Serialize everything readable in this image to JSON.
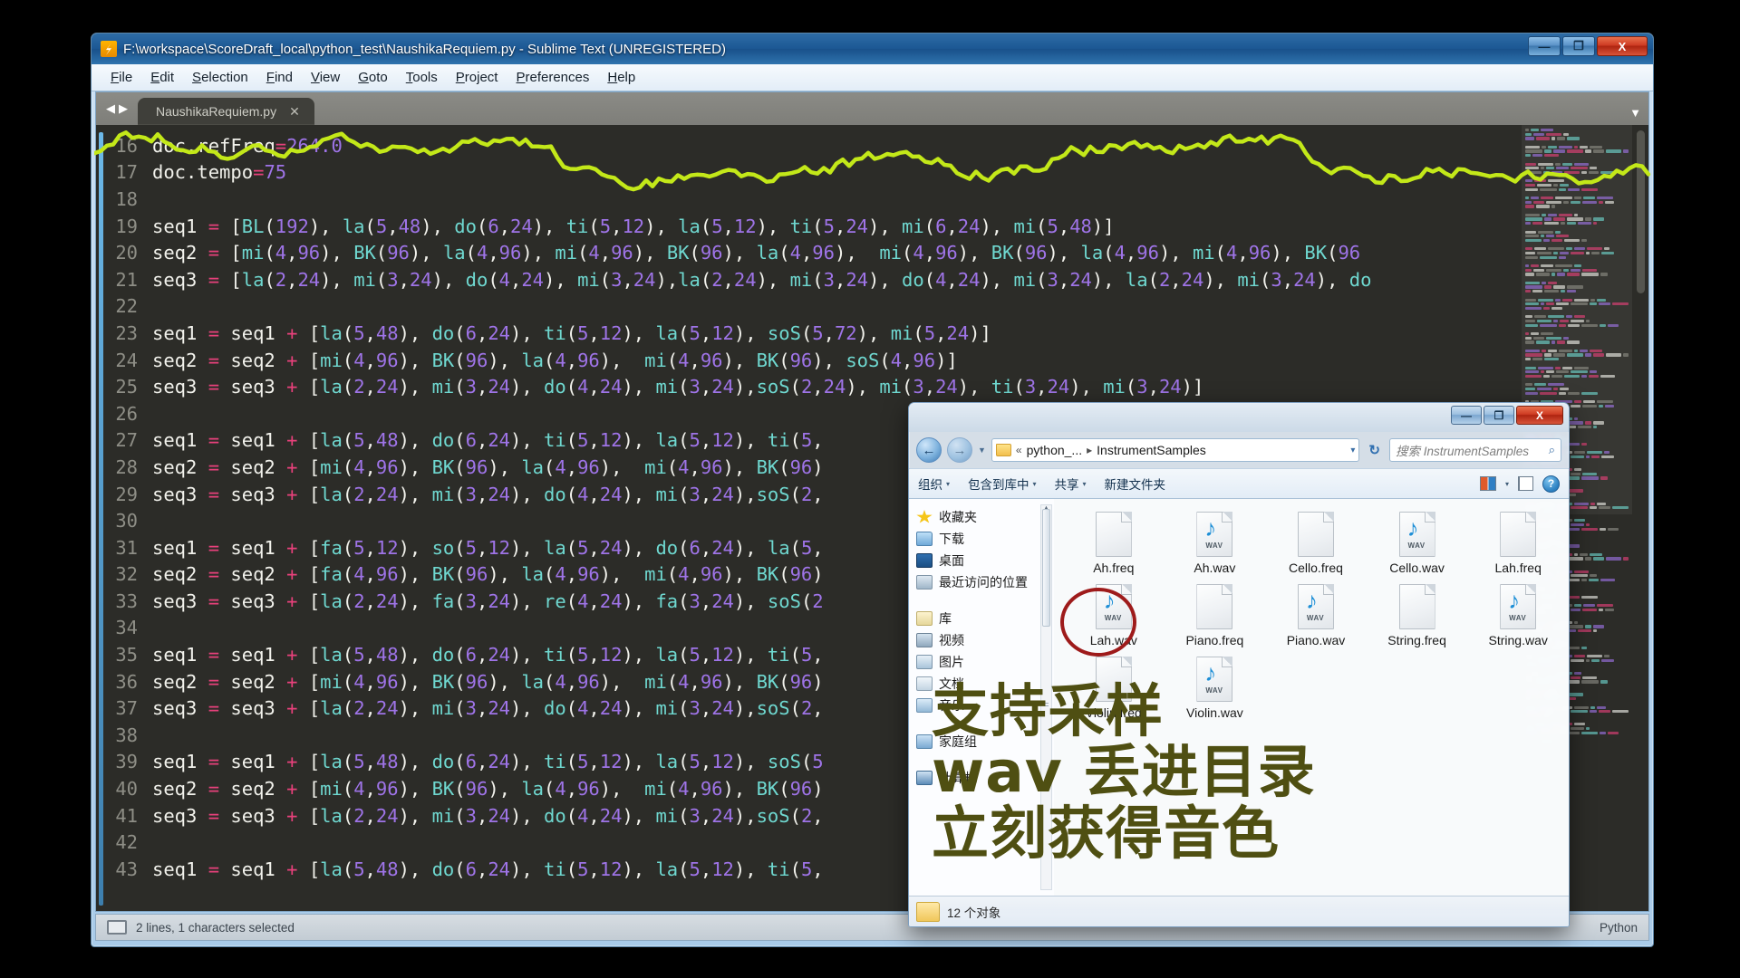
{
  "sublime": {
    "title": "F:\\workspace\\ScoreDraft_local\\python_test\\NaushikaRequiem.py - Sublime Text (UNREGISTERED)",
    "window_buttons": {
      "minimize": "—",
      "maximize": "❐",
      "close": "X"
    },
    "menu": [
      "File",
      "Edit",
      "Selection",
      "Find",
      "View",
      "Goto",
      "Tools",
      "Project",
      "Preferences",
      "Help"
    ],
    "tab": {
      "label": "NaushikaRequiem.py",
      "close": "✕"
    },
    "tab_nav_prev": "◀",
    "tab_nav_next": "▶",
    "tab_overflow": "▼",
    "status_left": "2 lines, 1 characters selected",
    "status_right": "Python",
    "code_lines": [
      {
        "num": "16",
        "text": "doc.refFreq=264.0"
      },
      {
        "num": "17",
        "text": "doc.tempo=75"
      },
      {
        "num": "18",
        "text": ""
      },
      {
        "num": "19",
        "text": "seq1 = [BL(192), la(5,48), do(6,24), ti(5,12), la(5,12), ti(5,24), mi(6,24), mi(5,48)]"
      },
      {
        "num": "20",
        "text": "seq2 = [mi(4,96), BK(96), la(4,96), mi(4,96), BK(96), la(4,96),  mi(4,96), BK(96), la(4,96), mi(4,96), BK(96"
      },
      {
        "num": "21",
        "text": "seq3 = [la(2,24), mi(3,24), do(4,24), mi(3,24),la(2,24), mi(3,24), do(4,24), mi(3,24), la(2,24), mi(3,24), do"
      },
      {
        "num": "22",
        "text": ""
      },
      {
        "num": "23",
        "text": "seq1 = seq1 + [la(5,48), do(6,24), ti(5,12), la(5,12), soS(5,72), mi(5,24)]"
      },
      {
        "num": "24",
        "text": "seq2 = seq2 + [mi(4,96), BK(96), la(4,96),  mi(4,96), BK(96), soS(4,96)]"
      },
      {
        "num": "25",
        "text": "seq3 = seq3 + [la(2,24), mi(3,24), do(4,24), mi(3,24),soS(2,24), mi(3,24), ti(3,24), mi(3,24)]"
      },
      {
        "num": "26",
        "text": ""
      },
      {
        "num": "27",
        "text": "seq1 = seq1 + [la(5,48), do(6,24), ti(5,12), la(5,12), ti(5,"
      },
      {
        "num": "28",
        "text": "seq2 = seq2 + [mi(4,96), BK(96), la(4,96),  mi(4,96), BK(96)"
      },
      {
        "num": "29",
        "text": "seq3 = seq3 + [la(2,24), mi(3,24), do(4,24), mi(3,24),soS(2,"
      },
      {
        "num": "30",
        "text": ""
      },
      {
        "num": "31",
        "text": "seq1 = seq1 + [fa(5,12), so(5,12), la(5,24), do(6,24), la(5,"
      },
      {
        "num": "32",
        "text": "seq2 = seq2 + [fa(4,96), BK(96), la(4,96),  mi(4,96), BK(96)"
      },
      {
        "num": "33",
        "text": "seq3 = seq3 + [la(2,24), fa(3,24), re(4,24), fa(3,24), soS(2"
      },
      {
        "num": "34",
        "text": ""
      },
      {
        "num": "35",
        "text": "seq1 = seq1 + [la(5,48), do(6,24), ti(5,12), la(5,12), ti(5,"
      },
      {
        "num": "36",
        "text": "seq2 = seq2 + [mi(4,96), BK(96), la(4,96),  mi(4,96), BK(96)"
      },
      {
        "num": "37",
        "text": "seq3 = seq3 + [la(2,24), mi(3,24), do(4,24), mi(3,24),soS(2,"
      },
      {
        "num": "38",
        "text": ""
      },
      {
        "num": "39",
        "text": "seq1 = seq1 + [la(5,48), do(6,24), ti(5,12), la(5,12), soS(5"
      },
      {
        "num": "40",
        "text": "seq2 = seq2 + [mi(4,96), BK(96), la(4,96),  mi(4,96), BK(96)"
      },
      {
        "num": "41",
        "text": "seq3 = seq3 + [la(2,24), mi(3,24), do(4,24), mi(3,24),soS(2,"
      },
      {
        "num": "42",
        "text": ""
      },
      {
        "num": "43",
        "text": "seq1 = seq1 + [la(5,48), do(6,24), ti(5,12), la(5,12), ti(5,"
      }
    ]
  },
  "explorer": {
    "window_buttons": {
      "minimize": "—",
      "maximize": "❐",
      "close": "X"
    },
    "back_arrow": "←",
    "forward_arrow": "→",
    "address": {
      "crumb_prefix": "«",
      "crumb1": "python_...",
      "separator": "▸",
      "crumb2": "InstrumentSamples",
      "caret": "▾"
    },
    "refresh": "↻",
    "search_placeholder": "搜索 InstrumentSamples",
    "search_value": "",
    "search_icon": "⌕",
    "toolbar": [
      {
        "label": "组织",
        "caret": "▾"
      },
      {
        "label": "包含到库中",
        "caret": "▾"
      },
      {
        "label": "共享",
        "caret": "▾"
      },
      {
        "label": "新建文件夹",
        "caret": ""
      }
    ],
    "toolbar_view_caret": "▾",
    "help_label": "?",
    "sidebar": [
      {
        "label": "收藏夹",
        "icon": "ico-star"
      },
      {
        "label": "下载",
        "icon": "ico-dl"
      },
      {
        "label": "桌面",
        "icon": "ico-desktop"
      },
      {
        "label": "最近访问的位置",
        "icon": "ico-recent"
      },
      {
        "label": "库",
        "icon": "ico-lib"
      },
      {
        "label": "视频",
        "icon": "ico-video"
      },
      {
        "label": "图片",
        "icon": "ico-pic"
      },
      {
        "label": "文档",
        "icon": "ico-doc"
      },
      {
        "label": "音乐",
        "icon": "ico-music"
      },
      {
        "label": "家庭组",
        "icon": "ico-home"
      },
      {
        "label": "计算机",
        "icon": "ico-pc"
      }
    ],
    "sidebar_scroll_arrow": "▲",
    "files": [
      {
        "name": "Ah.freq",
        "type": "freq",
        "badge": ""
      },
      {
        "name": "Ah.wav",
        "type": "wav",
        "badge": "WAV"
      },
      {
        "name": "Cello.freq",
        "type": "freq",
        "badge": ""
      },
      {
        "name": "Cello.wav",
        "type": "wav",
        "badge": "WAV"
      },
      {
        "name": "Lah.freq",
        "type": "freq",
        "badge": ""
      },
      {
        "name": "Lah.wav",
        "type": "wav",
        "badge": "WAV"
      },
      {
        "name": "Piano.freq",
        "type": "freq",
        "badge": ""
      },
      {
        "name": "Piano.wav",
        "type": "wav",
        "badge": "WAV"
      },
      {
        "name": "String.freq",
        "type": "freq",
        "badge": ""
      },
      {
        "name": "String.wav",
        "type": "wav",
        "badge": "WAV"
      },
      {
        "name": "Violin.freq",
        "type": "freq",
        "badge": ""
      },
      {
        "name": "Violin.wav",
        "type": "wav",
        "badge": "WAV"
      }
    ],
    "status_text": "12 个对象",
    "highlighted_file": "Lah.wav"
  },
  "overlay": {
    "line1": "支持采样",
    "line2": "wav 丢进目录",
    "line3": "立刻获得音色",
    "color": "#4f4f12"
  },
  "colors": {
    "accent_green": "#c3e819",
    "highlight_red": "#9e1b1b",
    "editor_bg": "#2c2c28",
    "titlebar_blue": "#1c5894"
  }
}
